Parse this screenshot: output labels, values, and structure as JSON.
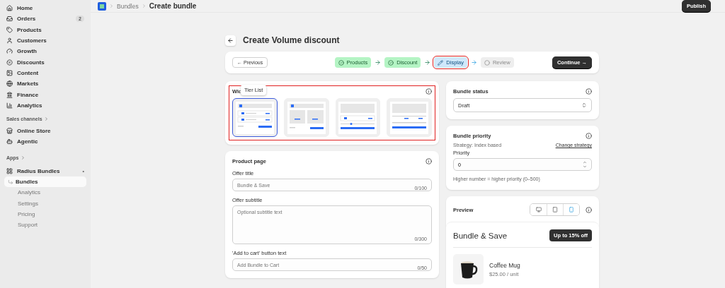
{
  "sidebar": {
    "items": [
      {
        "label": "Home",
        "selected": false
      },
      {
        "label": "Orders",
        "badge": "2",
        "selected": false
      },
      {
        "label": "Products",
        "selected": false
      },
      {
        "label": "Customers",
        "selected": false
      },
      {
        "label": "Growth",
        "selected": false
      },
      {
        "label": "Discounts",
        "selected": false
      },
      {
        "label": "Content",
        "selected": false
      },
      {
        "label": "Markets",
        "selected": false
      },
      {
        "label": "Finance",
        "selected": false
      },
      {
        "label": "Analytics",
        "selected": false
      }
    ],
    "sales_channels": {
      "heading": "Sales channels",
      "items": [
        {
          "label": "Online Store",
          "selected": false
        },
        {
          "label": "Agentic",
          "selected": false
        }
      ]
    },
    "apps": {
      "heading": "Apps",
      "app": {
        "label": "Radius Bundles",
        "pin": "•",
        "children": [
          {
            "label": "Bundles",
            "selected": true
          },
          {
            "label": "Analytics",
            "selected": false
          },
          {
            "label": "Settings",
            "selected": false
          },
          {
            "label": "Pricing",
            "selected": false
          },
          {
            "label": "Support",
            "selected": false
          }
        ]
      }
    }
  },
  "topbar": {
    "breadcrumbs": [
      "Bundles"
    ],
    "title": "Create bundle",
    "publish": "Publish"
  },
  "page": {
    "title": "Create Volume discount"
  },
  "stepper": {
    "previous": "← Previous",
    "continue": "Continue →",
    "steps": [
      {
        "label": "Products",
        "checked": true,
        "selected": false,
        "highlighted": false
      },
      {
        "label": "Discount",
        "checked": true,
        "selected": false,
        "highlighted": false
      },
      {
        "label": "Display",
        "checked": false,
        "selected": true,
        "highlighted": true
      },
      {
        "label": "Review",
        "checked": false,
        "selected": false,
        "highlighted": false
      }
    ]
  },
  "widget": {
    "title": "Wid",
    "tooltip": "Tier List",
    "highlighted": true,
    "templates": [
      {
        "selected": true
      },
      {
        "selected": false
      },
      {
        "selected": false
      },
      {
        "selected": false
      }
    ]
  },
  "product_page": {
    "title": "Product page",
    "fields": [
      {
        "kind": "input",
        "label": "Offer title",
        "placeholder": "Bundle & Save",
        "counter": "0/100"
      },
      {
        "kind": "textarea",
        "label": "Offer subtitle",
        "placeholder": "Optional subtitle text",
        "counter": "0/300"
      },
      {
        "kind": "input",
        "label": "'Add to cart' button text",
        "placeholder": "Add Bundle to Cart",
        "counter": "0/50"
      }
    ]
  },
  "bundle_status": {
    "title": "Bundle status",
    "value": "Draft"
  },
  "bundle_priority": {
    "title": "Bundle priority",
    "strategy": "Strategy: Index based",
    "change": "Change strategy",
    "label": "Priority",
    "value": "0",
    "help": "Higher number = higher priority (0–500)"
  },
  "preview": {
    "title": "Preview",
    "devices": [
      {
        "kind": "desktop",
        "selected": false
      },
      {
        "kind": "tablet",
        "selected": false
      },
      {
        "kind": "mobile",
        "selected": true
      }
    ],
    "heading": "Bundle & Save",
    "badge": "Up to 15% off",
    "product": {
      "name": "Coffee Mug",
      "price": "$25.00 / unit"
    }
  }
}
